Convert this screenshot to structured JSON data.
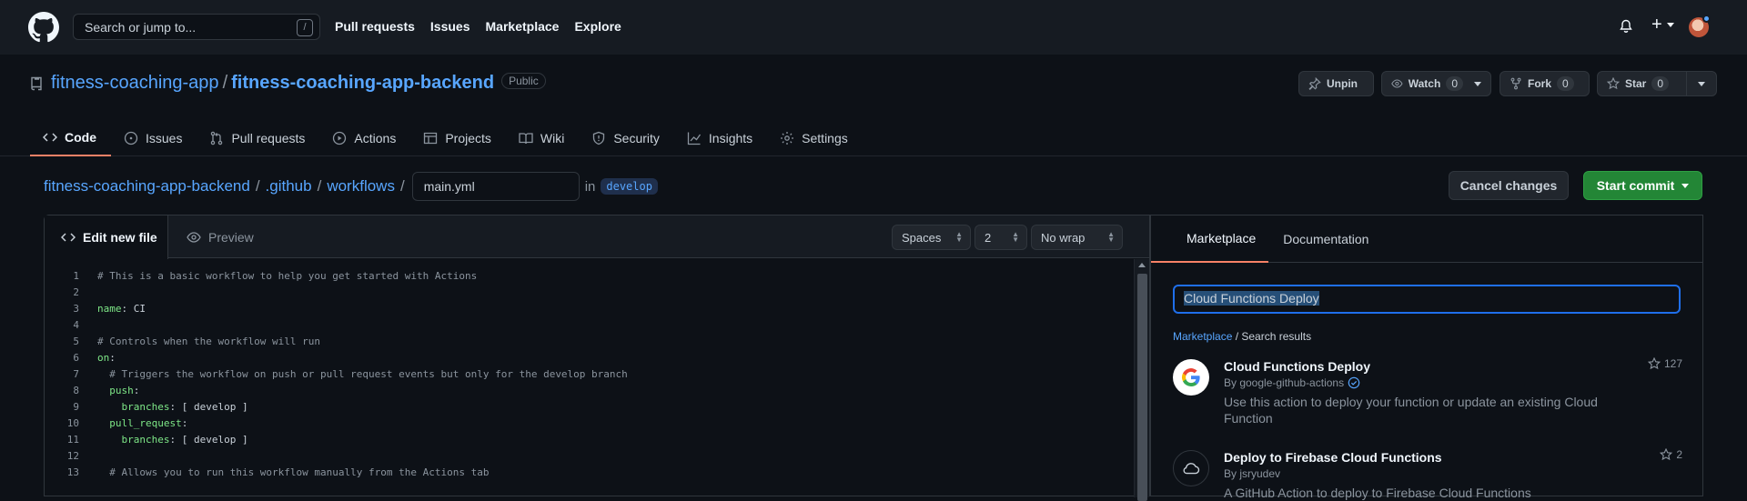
{
  "topbar": {
    "search_placeholder": "Search or jump to...",
    "search_key": "/",
    "nav": [
      "Pull requests",
      "Issues",
      "Marketplace",
      "Explore"
    ]
  },
  "repo": {
    "owner": "fitness-coaching-app",
    "name": "fitness-coaching-app-backend",
    "visibility": "Public",
    "unpin_label": "Unpin",
    "watch_label": "Watch",
    "watch_count": "0",
    "fork_label": "Fork",
    "fork_count": "0",
    "star_label": "Star",
    "star_count": "0"
  },
  "tabs": [
    "Code",
    "Issues",
    "Pull requests",
    "Actions",
    "Projects",
    "Wiki",
    "Security",
    "Insights",
    "Settings"
  ],
  "breadcrumb": {
    "root": "fitness-coaching-app-backend",
    "dir1": ".github",
    "dir2": "workflows",
    "filename": "main.yml",
    "in": "in",
    "branch": "develop"
  },
  "actions": {
    "cancel": "Cancel changes",
    "commit": "Start commit"
  },
  "editor": {
    "tab_edit": "Edit new file",
    "tab_preview": "Preview",
    "indent_mode": "Spaces",
    "indent_size": "2",
    "wrap_mode": "No wrap",
    "lines": [
      {
        "n": "1",
        "t": "# This is a basic workflow to help you get started with Actions"
      },
      {
        "n": "2",
        "t": ""
      },
      {
        "n": "3",
        "t": "name: CI"
      },
      {
        "n": "4",
        "t": ""
      },
      {
        "n": "5",
        "t": "# Controls when the workflow will run"
      },
      {
        "n": "6",
        "t": "on:"
      },
      {
        "n": "7",
        "t": "  # Triggers the workflow on push or pull request events but only for the develop branch"
      },
      {
        "n": "8",
        "t": "  push:"
      },
      {
        "n": "9",
        "t": "    branches: [ develop ]"
      },
      {
        "n": "10",
        "t": "  pull_request:"
      },
      {
        "n": "11",
        "t": "    branches: [ develop ]"
      },
      {
        "n": "12",
        "t": ""
      },
      {
        "n": "13",
        "t": "  # Allows you to run this workflow manually from the Actions tab"
      }
    ]
  },
  "sidebar": {
    "tab_marketplace": "Marketplace",
    "tab_documentation": "Documentation",
    "search_value": "Cloud Functions Deploy",
    "crumb_link": "Marketplace",
    "crumb_rest": " / Search results",
    "results": [
      {
        "title": "Cloud Functions Deploy",
        "by": "By google-github-actions",
        "desc": "Use this action to deploy your function or update an existing Cloud Function",
        "stars": "127"
      },
      {
        "title": "Deploy to Firebase Cloud Functions",
        "by": "By jsryudev",
        "desc": "A GitHub Action to deploy to Firebase Cloud Functions",
        "stars": "2"
      }
    ]
  }
}
